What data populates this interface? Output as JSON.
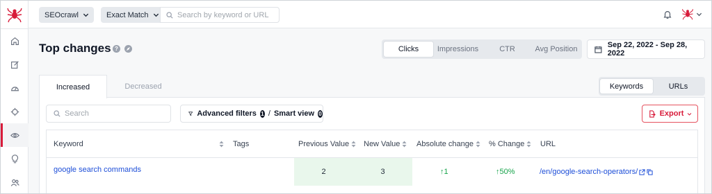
{
  "topbar": {
    "project": "SEOcrawl",
    "match_type": "Exact Match",
    "search_placeholder": "Search by keyword or URL"
  },
  "sidebar": {
    "items": [
      {
        "icon": "home-icon"
      },
      {
        "icon": "edit-icon"
      },
      {
        "icon": "dashboard-icon"
      },
      {
        "icon": "crosshair-icon"
      },
      {
        "icon": "eye-icon",
        "active": true
      },
      {
        "icon": "lightbulb-icon"
      },
      {
        "icon": "users-icon"
      }
    ]
  },
  "header": {
    "title": "Top changes",
    "help": "?",
    "metrics": [
      "Clicks",
      "Impressions",
      "CTR",
      "Avg Position"
    ],
    "active_metric": "Clicks",
    "date_range": "Sep 22, 2022 - Sep 28, 2022"
  },
  "tabs": {
    "increased": "Increased",
    "decreased": "Decreased",
    "active": "Increased"
  },
  "view_toggle": {
    "keywords": "Keywords",
    "urls": "URLs",
    "active": "Keywords"
  },
  "toolbar": {
    "search_placeholder": "Search",
    "advanced_filters": "Advanced filters",
    "advanced_count": "1",
    "smart_view": "Smart view",
    "smart_count": "0",
    "export": "Export"
  },
  "table": {
    "headers": [
      "Keyword",
      "Tags",
      "Previous Value",
      "New Value",
      "Absolute change",
      "% Change",
      "URL"
    ],
    "rows": [
      {
        "keyword": "google search commands",
        "tags": "",
        "previous_value": "2",
        "new_value": "3",
        "absolute_change": "1",
        "pct_change": "50%",
        "url": "/en/google-search-operators/"
      }
    ]
  },
  "colors": {
    "accent": "#d81b3a",
    "positive": "#16a34a",
    "link": "#1d4ed8",
    "highlight_cell": "#e9f7ec"
  }
}
